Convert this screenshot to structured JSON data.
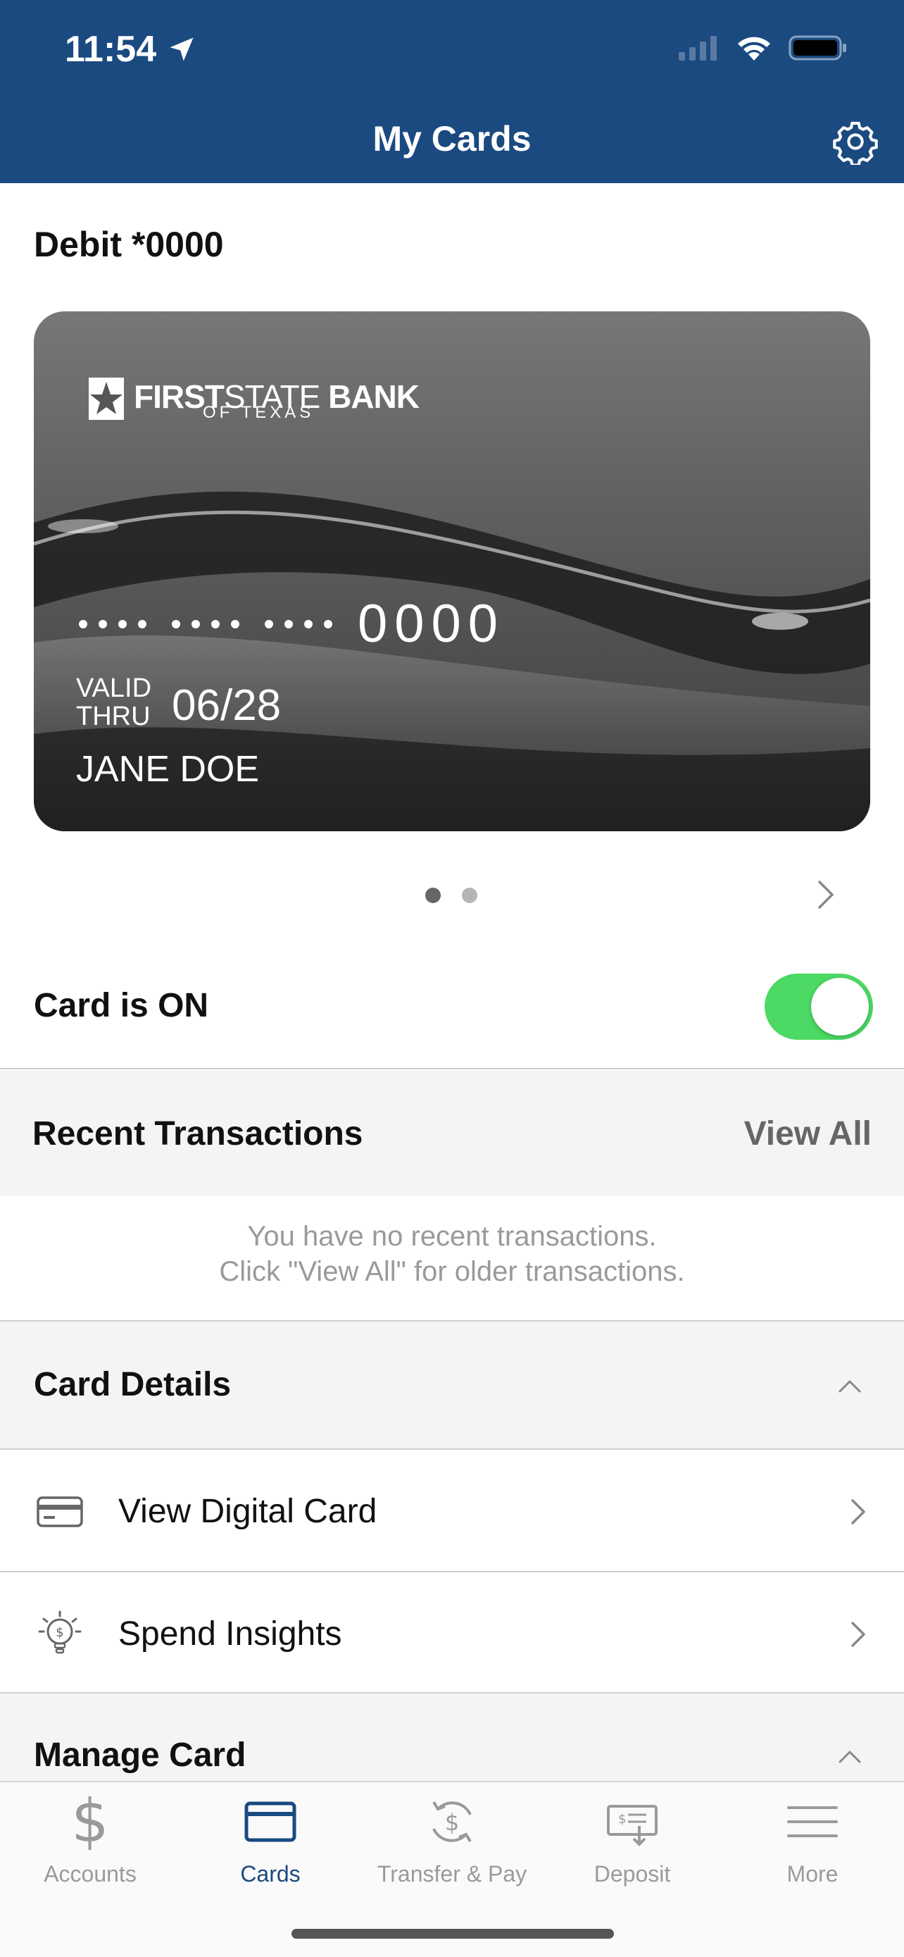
{
  "status_bar": {
    "time": "11:54"
  },
  "header": {
    "title": "My Cards"
  },
  "card": {
    "section_label": "Debit *0000",
    "bank_name_bold_1": "FIRST",
    "bank_name_light": "STATE",
    "bank_name_bold_2": "BANK",
    "bank_subline": "OF TEXAS",
    "last_four": "0000",
    "valid_line_1": "VALID",
    "valid_line_2": "THRU",
    "expiry": "06/28",
    "holder": "JANE DOE",
    "pager_count": 2,
    "pager_active_index": 0
  },
  "card_status": {
    "label": "Card is ON",
    "enabled": true
  },
  "recent_transactions": {
    "title": "Recent Transactions",
    "view_all": "View All",
    "empty_line_1": "You have no recent transactions.",
    "empty_line_2": "Click \"View All\" for older transactions."
  },
  "card_details": {
    "title": "Card Details",
    "items": [
      {
        "label": "View Digital Card",
        "icon": "credit-card-icon"
      },
      {
        "label": "Spend Insights",
        "icon": "lightbulb-dollar-icon"
      }
    ]
  },
  "manage_card": {
    "title": "Manage Card"
  },
  "tabbar": {
    "tabs": [
      {
        "label": "Accounts",
        "icon": "dollar-icon"
      },
      {
        "label": "Cards",
        "icon": "card-icon",
        "active": true
      },
      {
        "label": "Transfer & Pay",
        "icon": "transfer-icon"
      },
      {
        "label": "Deposit",
        "icon": "check-deposit-icon"
      },
      {
        "label": "More",
        "icon": "menu-icon"
      }
    ]
  },
  "colors": {
    "header_bg": "#1a4a80",
    "toggle_on": "#4cd964",
    "accent": "#1a4a80"
  }
}
